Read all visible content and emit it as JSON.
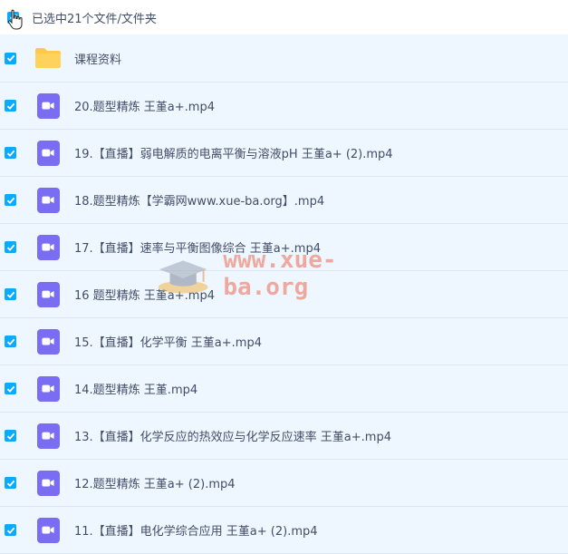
{
  "header": {
    "selection_text": "已选中21个文件/文件夹"
  },
  "watermark": {
    "text": "www.xue-ba.org"
  },
  "colors": {
    "checkbox": "#09aaff",
    "video_icon": "#7b6cf4",
    "folder": "#ffc94a",
    "row_bg": "#eef6ff",
    "text": "#424e67"
  },
  "files": [
    {
      "name": "课程资料",
      "type": "folder",
      "icon": "folder-icon"
    },
    {
      "name": "20.题型精炼 王堇a+.mp4",
      "type": "video",
      "icon": "video-icon"
    },
    {
      "name": "19.【直播】弱电解质的电离平衡与溶液pH 王堇a+ (2).mp4",
      "type": "video",
      "icon": "video-icon"
    },
    {
      "name": "18.题型精炼【学霸网www.xue-ba.org】.mp4",
      "type": "video",
      "icon": "video-icon"
    },
    {
      "name": "17.【直播】速率与平衡图像综合 王堇a+.mp4",
      "type": "video",
      "icon": "video-icon"
    },
    {
      "name": "16 题型精炼 王堇a+.mp4",
      "type": "video",
      "icon": "video-icon"
    },
    {
      "name": "15.【直播】化学平衡 王堇a+.mp4",
      "type": "video",
      "icon": "video-icon"
    },
    {
      "name": "14.题型精炼 王堇.mp4",
      "type": "video",
      "icon": "video-icon"
    },
    {
      "name": "13.【直播】化学反应的热效应与化学反应速率 王堇a+.mp4",
      "type": "video",
      "icon": "video-icon"
    },
    {
      "name": "12.题型精炼 王堇a+ (2).mp4",
      "type": "video",
      "icon": "video-icon"
    },
    {
      "name": "11.【直播】电化学综合应用 王堇a+ (2).mp4",
      "type": "video",
      "icon": "video-icon"
    }
  ]
}
